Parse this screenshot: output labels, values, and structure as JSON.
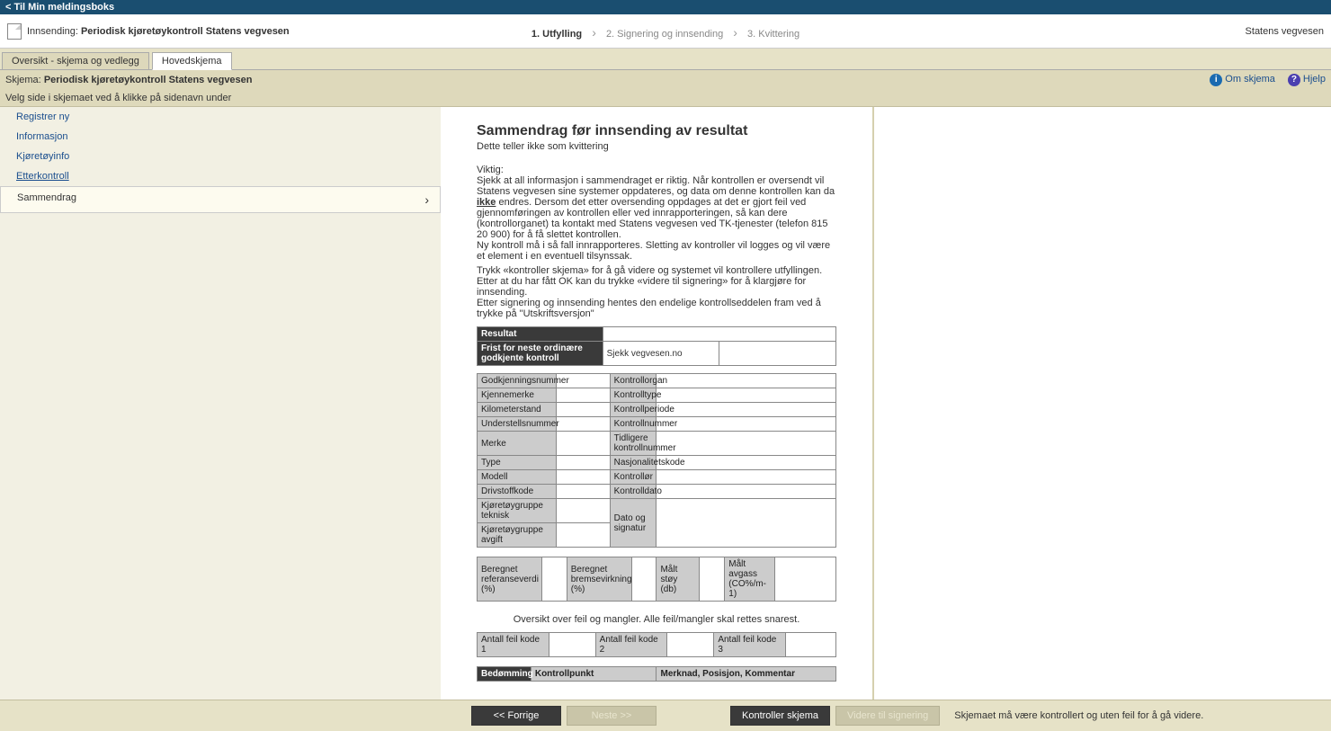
{
  "topbar": {
    "back": "< Til Min meldingsboks"
  },
  "header": {
    "sending_prefix": "Innsending:",
    "sending_title": "Periodisk kjøretøykontroll Statens vegvesen",
    "owner": "Statens vegvesen",
    "steps": [
      "1. Utfylling",
      "2. Signering og innsending",
      "3. Kvittering"
    ]
  },
  "tabs": {
    "overview": "Oversikt - skjema og vedlegg",
    "main": "Hovedskjema"
  },
  "form_title": {
    "prefix": "Skjema:",
    "name": "Periodisk kjøretøykontroll Statens vegvesen"
  },
  "help": {
    "om": "Om skjema",
    "hjelp": "Hjelp"
  },
  "instruction": "Velg side i skjemaet ved å klikke på sidenavn under",
  "sidebar": {
    "items": [
      "Registrer ny",
      "Informasjon",
      "Kjøretøyinfo",
      "Etterkontroll",
      "Sammendrag"
    ]
  },
  "content": {
    "heading": "Sammendrag før innsending av resultat",
    "subtitle": "Dette teller ikke som kvittering",
    "important_label": "Viktig:",
    "p1a": "Sjekk at all informasjon i sammendraget er riktig. Når kontrollen er oversendt vil Statens vegvesen sine systemer oppdateres, og data om denne kontrollen kan da ",
    "p1_ikke": "ikke",
    "p1b": " endres.",
    "p2": "Dersom det etter oversending oppdages at det er gjort feil ved gjennomføringen av kontrollen eller ved innrapporteringen, så kan dere (kontrollorganet) ta kontakt med Statens vegvesen ved TK-tjenester (telefon 815 20 900) for å få slettet kontrollen.",
    "p3": "Ny kontroll må i så fall innrapporteres. Sletting av kontroller vil logges og vil være et element i en eventuell tilsynssak.",
    "p4": "Trykk «kontroller skjema» for å gå videre og systemet vil kontrollere utfyllingen. Etter at du har fått OK kan du trykke «videre til signering» for å klargjøre for innsending.",
    "p5": "Etter signering og innsending hentes den endelige kontrollseddelen fram ved å trykke på \"Utskriftsversjon\""
  },
  "result_table": {
    "resultat": "Resultat",
    "frist": "Frist for neste ordinære godkjente kontroll",
    "sjekk": "Sjekk vegvesen.no"
  },
  "details": {
    "godkjenningsnummer": "Godkjenningsnummer",
    "kontrollorgan": "Kontrollorgan",
    "kjennemerke": "Kjennemerke",
    "kontrolltype": "Kontrolltype",
    "kilometerstand": "Kilometerstand",
    "kontrollperiode": "Kontrollperiode",
    "understellsnummer": "Understellsnummer",
    "kontrollnummer": "Kontrollnummer",
    "merke": "Merke",
    "tidligere": "Tidligere kontrollnummer",
    "type": "Type",
    "nasjonalitet": "Nasjonalitetskode",
    "modell": "Modell",
    "kontrollor": "Kontrollør",
    "drivstoff": "Drivstoffkode",
    "kontrolldato": "Kontrolldato",
    "kjt_teknisk": "Kjøretøygruppe teknisk",
    "dato_sig": "Dato og signatur",
    "kjt_avgift": "Kjøretøygruppe avgift"
  },
  "measure": {
    "ref": "Beregnet referanseverdi (%)",
    "brems": "Beregnet bremsevirkning (%)",
    "stoy": "Målt støy (db)",
    "avgass": "Målt avgass (CO%/m-1)"
  },
  "overview": "Oversikt over feil og mangler. Alle feil/mangler skal rettes snarest.",
  "codes": {
    "k1": "Antall feil kode 1",
    "k2": "Antall feil kode 2",
    "k3": "Antall feil kode 3"
  },
  "errors_hdr": {
    "bedom": "Bedømming",
    "kontrollpunkt": "Kontrollpunkt",
    "merknad": "Merknad, Posisjon, Kommentar"
  },
  "bottom": {
    "prev": "<< Forrige",
    "next": "Neste >>",
    "check": "Kontroller skjema",
    "sign": "Videre til signering",
    "msg": "Skjemaet må være kontrollert og uten feil for å gå videre."
  }
}
